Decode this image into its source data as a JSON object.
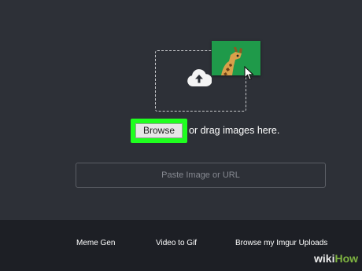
{
  "upload": {
    "browse_label": "Browse",
    "drag_text": "or drag images here.",
    "url_placeholder": "Paste Image or URL"
  },
  "footer": {
    "links": [
      {
        "label": "Meme Gen"
      },
      {
        "label": "Video to Gif"
      },
      {
        "label": "Browse my Imgur Uploads"
      }
    ]
  },
  "watermark": {
    "wiki": "wiki",
    "how": "How"
  },
  "colors": {
    "background": "#2d3037",
    "footer": "#1d1f25",
    "highlight": "#1fff1f",
    "thumbnail": "#1f9a4a"
  },
  "icons": [
    "cloud-upload-icon",
    "giraffe-thumbnail",
    "cursor-icon"
  ]
}
